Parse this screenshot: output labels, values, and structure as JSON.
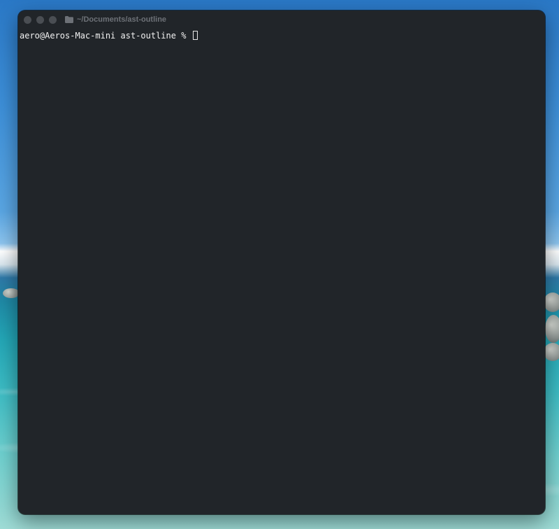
{
  "window": {
    "title": "~/Documents/ast-outline",
    "folder_icon": "folder-icon",
    "colors": {
      "background": "#212529",
      "text": "#f2f2f2",
      "title_text": "#6d7177",
      "traffic_light": "#4a4e53"
    }
  },
  "terminal": {
    "prompt": "aero@Aeros-Mac-mini ast-outline % "
  }
}
